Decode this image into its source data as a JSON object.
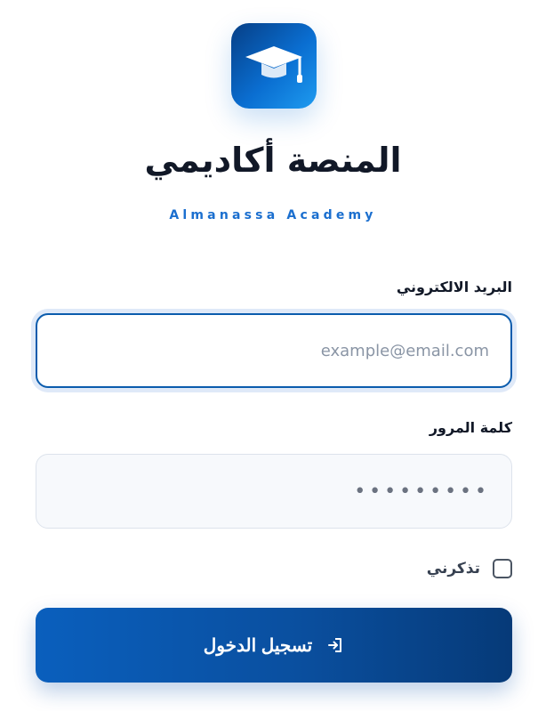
{
  "brand": {
    "title": "المنصة أكاديمي",
    "subtitle": "Almanassa Academy",
    "logo_icon": "graduation-cap-icon",
    "accent": "#0a6ed1"
  },
  "login_form": {
    "email_label": "البريد الالكتروني",
    "email_placeholder": "example@email.com",
    "email_value": "",
    "password_label": "كلمة المرور",
    "password_value": "•••••••••",
    "remember_label": "تذكرني",
    "remember_checked": false,
    "submit_label": "تسجيل الدخول",
    "submit_icon": "sign-in-icon"
  }
}
